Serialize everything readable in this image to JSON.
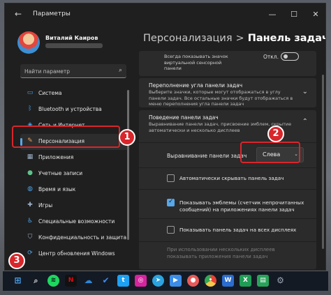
{
  "window": {
    "title": "Параметры",
    "back_icon": "back-arrow-icon",
    "controls": [
      "minimize",
      "maximize",
      "close"
    ]
  },
  "user": {
    "name": "Виталий Каиров"
  },
  "search": {
    "placeholder": "Найти параметр"
  },
  "sidebar": {
    "items": [
      {
        "label": "Система",
        "icon": "monitor-icon",
        "color": "#4aa3ec"
      },
      {
        "label": "Bluetooth и устройства",
        "icon": "bluetooth-icon",
        "color": "#4aa3ec"
      },
      {
        "label": "Сеть и Интернет",
        "icon": "wifi-icon",
        "color": "#4aa3ec"
      },
      {
        "label": "Персонализация",
        "icon": "brush-icon",
        "color": "#f0a35e",
        "active": true
      },
      {
        "label": "Приложения",
        "icon": "apps-icon",
        "color": "#9fb2c9"
      },
      {
        "label": "Учетные записи",
        "icon": "person-icon",
        "color": "#5fc38a"
      },
      {
        "label": "Время и язык",
        "icon": "globe-icon",
        "color": "#4aa3ec"
      },
      {
        "label": "Игры",
        "icon": "gamepad-icon",
        "color": "#9fb2c9"
      },
      {
        "label": "Специальные возможности",
        "icon": "accessibility-icon",
        "color": "#4aa3ec"
      },
      {
        "label": "Конфиденциальность и защита",
        "icon": "shield-icon",
        "color": "#9fb2c9"
      },
      {
        "label": "Центр обновления Windows",
        "icon": "update-icon",
        "color": "#4aa3ec"
      }
    ]
  },
  "breadcrumb": {
    "parent": "Персонализация",
    "separator": ">",
    "current": "Панель задач"
  },
  "top_card": {
    "text": "Всегда показывать значок виртуальной сенсорной панели",
    "toggle_label": "Откл."
  },
  "overflow": {
    "title": "Переполнение угла панели задач",
    "description": "Выберите значки, которые могут отображаться в углу панели задач. Все остальные значки будут отображаться в меню переполнения угла панели задач"
  },
  "behavior": {
    "title": "Поведение панели задач",
    "description": "Выравнивание панели задач, присвоение эмблем, скрытие автоматически и несколько дисплеев",
    "alignment_label": "Выравнивание панели задач",
    "alignment_value": "Слева",
    "options": [
      {
        "label": "Автоматически скрывать панель задач",
        "checked": false
      },
      {
        "label": "Показывать эмблемы (счетчик непрочитанных сообщений) на приложениях панели задач",
        "line1": "Показывать эмблемы (счетчик непрочитанных",
        "line2": "сообщений) на приложениях панели задач",
        "checked": true
      },
      {
        "label": "Показывать панель задач на всех дисплеях",
        "checked": false
      }
    ],
    "multi_display_line1": "При использовании нескольких дисплеев",
    "multi_display_line2": "показывать приложения панели задач"
  },
  "annotations": {
    "badge_1": "1",
    "badge_2": "2",
    "badge_3": "3"
  },
  "taskbar": {
    "icons": [
      {
        "name": "start-icon",
        "color": "#4aa3ec"
      },
      {
        "name": "search-icon",
        "color": "#dddddd"
      },
      {
        "name": "spotify-icon",
        "color": "#1ed760"
      },
      {
        "name": "netflix-icon",
        "color": "#e50914"
      },
      {
        "name": "onedrive-icon",
        "color": "#2b88d8"
      },
      {
        "name": "todo-icon",
        "color": "#3b8ef0"
      },
      {
        "name": "twitter-icon",
        "color": "#1da1f2"
      },
      {
        "name": "instagram-icon",
        "color": "#d6249f"
      },
      {
        "name": "telegram-icon",
        "color": "#2aa3df"
      },
      {
        "name": "video-icon",
        "color": "#3c8de8"
      },
      {
        "name": "media-icon",
        "color": "#e85a5a"
      },
      {
        "name": "chrome-icon",
        "color": "#f2c94c"
      },
      {
        "name": "word-icon",
        "color": "#2b6ccf"
      },
      {
        "name": "excel-icon",
        "color": "#1f9d55"
      },
      {
        "name": "sheets-icon",
        "color": "#29a35a"
      },
      {
        "name": "settings-icon",
        "color": "#9aa4b5"
      }
    ]
  }
}
